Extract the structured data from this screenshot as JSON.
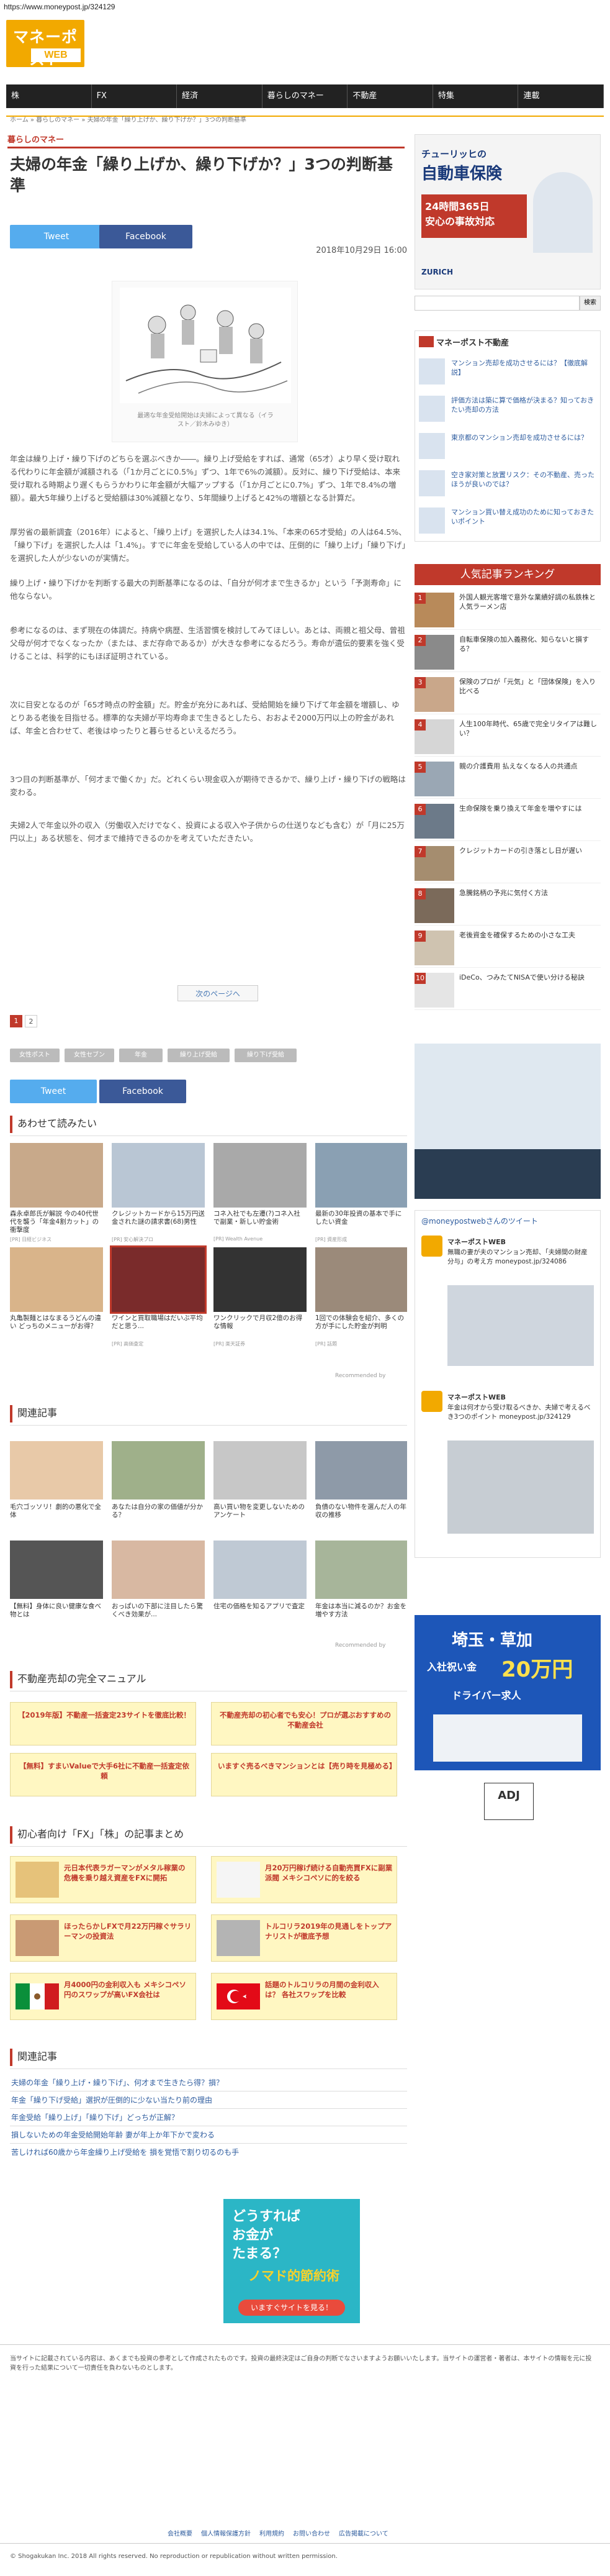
{
  "url": "https://www.moneypost.jp/324129",
  "logo": {
    "main": "マネーポスト",
    "sub": "WEB"
  },
  "gnav": [
    "株",
    "FX",
    "経済",
    "暮らしのマネー",
    "不動産",
    "特集",
    "連載"
  ],
  "breadcrumb": "ホーム » 暮らしのマネー » 夫婦の年金「繰り上げか、繰り下げか？」3つの判断基準",
  "article": {
    "category": "暮らしのマネー",
    "title": "夫婦の年金「繰り上げか、繰り下げか？」3つの判断基準",
    "date": "2018年10月29日 16:00",
    "tweet": "Tweet",
    "facebook": "Facebook",
    "figure_caption": "最適な年金受給開始は夫婦によって異なる（イラスト／鈴木みゆき）",
    "paragraphs": [
      "年金は繰り上げ・繰り下げのどちらを選ぶべきか――。繰り上げ受給をすれば、通常（65才）より早く受け取れる代わりに年金額が減額される（「1か月ごとに0.5%」ずつ、1年で6%の減額）。反対に、繰り下げ受給は、本来受け取れる時期より遅くもらうかわりに年金額が大幅アップする（「1か月ごとに0.7%」ずつ、1年で8.4%の増額）。最大5年繰り上げると受給額は30%減額となり、5年間繰り上げると42%の増額となる計算だ。",
      "厚労省の最新調査（2016年）によると、「繰り上げ」を選択した人は34.1%、「本来の65才受給」の人は64.5%、「繰り下げ」を選択した人は「1.4%」。すでに年金を受給している人の中では、圧倒的に「繰り上げ」「繰り下げ」を選択した人が少ないのが実情だ。",
      "繰り上げ・繰り下げかを判断する最大の判断基準になるのは、「自分が何才まで生きるか」という「予測寿命」に他ならない。",
      "参考になるのは、まず現在の体調だ。持病や病歴、生活習慣を検討してみてほしい。あとは、両親と祖父母、曾祖父母が何才でなくなったか（または、まだ存命であるか）が大きな参考になるだろう。寿命が遺伝的要素を強く受けることは、科学的にもほぼ証明されている。",
      "次に目安となるのが「65才時点の貯金額」だ。貯金が充分にあれば、受給開始を繰り下げて年金額を増額し、ゆとりある老後を目指せる。標準的な夫婦が平均寿命まで生きるとしたら、おおよそ2000万円以上の貯金があれば、年金と合わせて、老後はゆったりと暮らせるといえるだろう。",
      "3つ目の判断基準が、「何才まで働くか」だ。どれくらい現金収入が期待できるかで、繰り上げ・繰り下げの戦略は変わる。",
      "夫婦2人で年金以外の収入（労働収入だけでなく、投資による収入や子供からの仕送りなども含む）が「月に25万円以上」ある状態を、何才まで維持できるのかを考えていただきたい。"
    ],
    "next_page": "次のページへ",
    "pages": [
      "1",
      "2"
    ],
    "tags": [
      "女性ポスト",
      "女性セブン",
      "年金",
      "繰り上げ受給",
      "繰り下げ受給"
    ]
  },
  "recommend": {
    "heading": "あわせて読みたい",
    "items": [
      {
        "cap": "森永卓郎氏が解説 今の40代世代を襲う「年金4割カット」の衝撃度",
        "src": "[PR] 日経ビジネス"
      },
      {
        "cap": "クレジットカードから15万円送金された謎の請求書(68)男性",
        "src": "[PR] 安心解決プロ"
      },
      {
        "cap": "コネ入社でも左遷(?)コネ入社で副業・新しい貯金術",
        "src": "[PR] Wealth Avenue"
      },
      {
        "cap": "最新の30年投資の基本で手にしたい資金",
        "src": "[PR] 資産形成"
      },
      {
        "cap": "丸亀製麺とはなまるうどんの違い どっちのメニューがお得？",
        "src": ""
      },
      {
        "cap": "ワインと買取職場はだいぶ平均だと思う...",
        "src": "[PR] 高価査定"
      },
      {
        "cap": "ワンクリックで月収2億のお得な情報",
        "src": "[PR] 楽天証券"
      },
      {
        "cap": "1回での体験会を紹介、多くの方が手にした貯金が判明",
        "src": "[PR] 話題"
      }
    ],
    "recommended_by": "Recommended by"
  },
  "related": {
    "heading": "関連記事",
    "items": [
      {
        "cap": "毛穴ゴッソリ！劇的の悪化で全体",
        "src": ""
      },
      {
        "cap": "あなたは自分の家の価値が分かる？",
        "src": ""
      },
      {
        "cap": "高い買い物を変更しないためのアンケート",
        "src": ""
      },
      {
        "cap": "負債のない物件を選んだ人の年収の推移",
        "src": ""
      },
      {
        "cap": "【無料】身体に良い健康な食べ物とは",
        "src": ""
      },
      {
        "cap": "おっぱいの下部に注目したら驚くべき効果が...",
        "src": ""
      },
      {
        "cap": "住宅の価格を知るアプリで査定",
        "src": ""
      },
      {
        "cap": "年金は本当に減るのか？お金を増やす方法",
        "src": ""
      }
    ],
    "recommended_by": "Recommended by"
  },
  "manual": {
    "heading": "不動産売却の完全マニュアル",
    "cards": [
      "【2019年版】不動産一括査定23サイトを徹底比較！",
      "不動産売却の初心者でも安心！プロが選ぶおすすめの不動産会社",
      "【無料】すまいValueで大手6社に不動産一括査定依頼",
      "いますぐ売るべきマンションとは【売り時を見極める】"
    ]
  },
  "guide": {
    "heading": "初心者向け「FX」「株」の記事まとめ",
    "cards": [
      "元日本代表ラガーマンがメタル稼業の危機を乗り越え資産をFXに開拓",
      "月20万円稼げ続ける自動売買FXに副業派閥 メキシコペソに的を絞る",
      "ほったらかしFXで月22万円稼ぐサラリーマンの投資法",
      "トルコリラ2019年の見通しをトップアナリストが徹底予想",
      "月4000円の金利収入も メキシコペソ円のスワップが高いFX会社は",
      "話題のトルコリラの月間の金利収入は？ 各社スワップを比較"
    ]
  },
  "related_links": {
    "heading": "関連記事",
    "items": [
      "夫婦の年金「繰り上げ・繰り下げ」、何才まで生きたら得？損？",
      "年金「繰り下げ受給」選択が圧倒的に少ない当たり前の理由",
      "年金受給「繰り上げ」「繰り下げ」どっちが正解？",
      "損しないための年金受給開始年齢 妻が年上か年下かで変わる",
      "苦しければ60歳から年金繰り上げ受給を 損を覚悟で割り切るのも手"
    ]
  },
  "banner_bottom": {
    "line1": "どうすれば",
    "line2": "お金が",
    "line3": "たまる？",
    "line4": "ノマド的節約術",
    "cta": "いますぐサイトを見る！"
  },
  "footer": {
    "notice": "当サイトに記載されている内容は、あくまでも投資の参考として作成されたものです。投資の最終決定はご自身の判断でなさいますようお願いいたします。当サイトの運営者・著者は、本サイトの情報を元に投資を行った結果について一切責任を負わないものとします。",
    "links": [
      "会社概要",
      "個人情報保護方針",
      "利用規約",
      "お問い合わせ",
      "広告掲載について"
    ],
    "copyright": "© Shogakukan Inc. 2018 All rights reserved. No reproduction or republication without written permission."
  },
  "sidebar": {
    "ad_top": {
      "line1": "チューリッヒの",
      "line2": "自動車保険",
      "line3": "24時間365日",
      "line4": "安心の事故対応",
      "brand": "ZURICH"
    },
    "search_button": "検索",
    "re_head": "マネーポスト不動産",
    "re_items": [
      "マンション売却を成功させるには？【徹底解説】",
      "評価方法は築に算で価格が決まる？知っておきたい売却の方法",
      "東京都のマンション売却を成功させるには？",
      "空き家対策と放置リスク：その不動産、売ったほうが良いのでは？",
      "マンション買い替え成功のために知っておきたいポイント"
    ],
    "ranking_head": "人気記事ランキング",
    "ranking": [
      "外国人観光客増で意外な業績好調の私鉄株と人気ラーメン店",
      "自転車保険の加入義務化、知らないと損する？",
      "保険のプロが「元気」と「団体保険」を入り比べる",
      "人生100年時代、65歳で完全リタイアは難しい？",
      "親の介護費用 払えなくなる人の共通点",
      "生命保険を乗り換えて年金を増やすには",
      "クレジットカードの引き落とし日が遅い",
      "急騰銘柄の予兆に気付く方法",
      "老後資金を確保するための小さな工夫",
      "iDeCo、つみたてNISAで使い分ける秘訣"
    ],
    "tweet_head": "@moneypostwebさんのツイート",
    "tweet_account": "マネーポストWEB",
    "tweet_text1": "無職の妻が夫のマンション売却、「夫婦間の財産分与」の考え方 moneypost.jp/324086",
    "tweet_text2": "年金は何才から受け取るべきか、夫婦で考えるべき3つのポイント moneypost.jp/324129",
    "ad_bottom_line1": "埼玉・草加",
    "ad_bottom_line2": "入社祝い金",
    "ad_bottom_line3": "20万円",
    "ad_bottom_line4": "ドライバー求人",
    "adj": "ADJ"
  }
}
